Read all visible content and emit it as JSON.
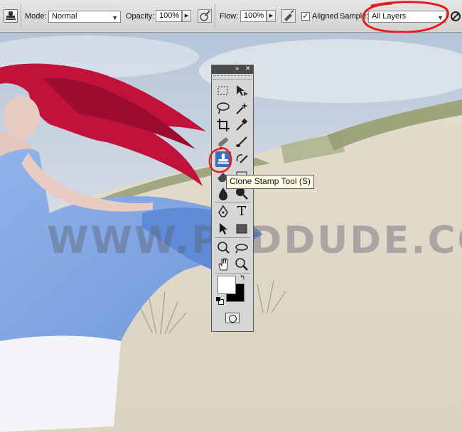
{
  "options_bar": {
    "mode_label": "Mode:",
    "mode_value": "Normal",
    "opacity_label": "Opacity:",
    "opacity_value": "100%",
    "flow_label": "Flow:",
    "flow_value": "100%",
    "aligned_label": "Aligned",
    "aligned_checked": true,
    "sample_label": "Sample:",
    "sample_value": "All Layers"
  },
  "tools_panel": {
    "collapse_glyph": "»",
    "close_glyph": "✕",
    "tools": [
      "marquee-tool",
      "move-tool",
      "lasso-tool",
      "quick-selection-tool",
      "crop-tool",
      "eyedropper-tool",
      "spot-healing-brush-tool",
      "brush-tool",
      "clone-stamp-tool",
      "history-brush-tool",
      "eraser-tool",
      "gradient-tool",
      "blur-tool",
      "dodge-tool",
      "pen-tool",
      "type-tool",
      "path-selection-tool",
      "rectangle-tool",
      "3d-rotate-tool",
      "3d-orbit-tool",
      "hand-tool",
      "zoom-tool"
    ],
    "type_tool_glyph": "T",
    "active_tool": "clone-stamp-tool"
  },
  "tooltip": {
    "text": "Clone Stamp Tool (S)"
  },
  "watermark": {
    "text": "WWW.PSDDUDE.COM"
  },
  "annotation": {
    "color": "#e8191c"
  }
}
